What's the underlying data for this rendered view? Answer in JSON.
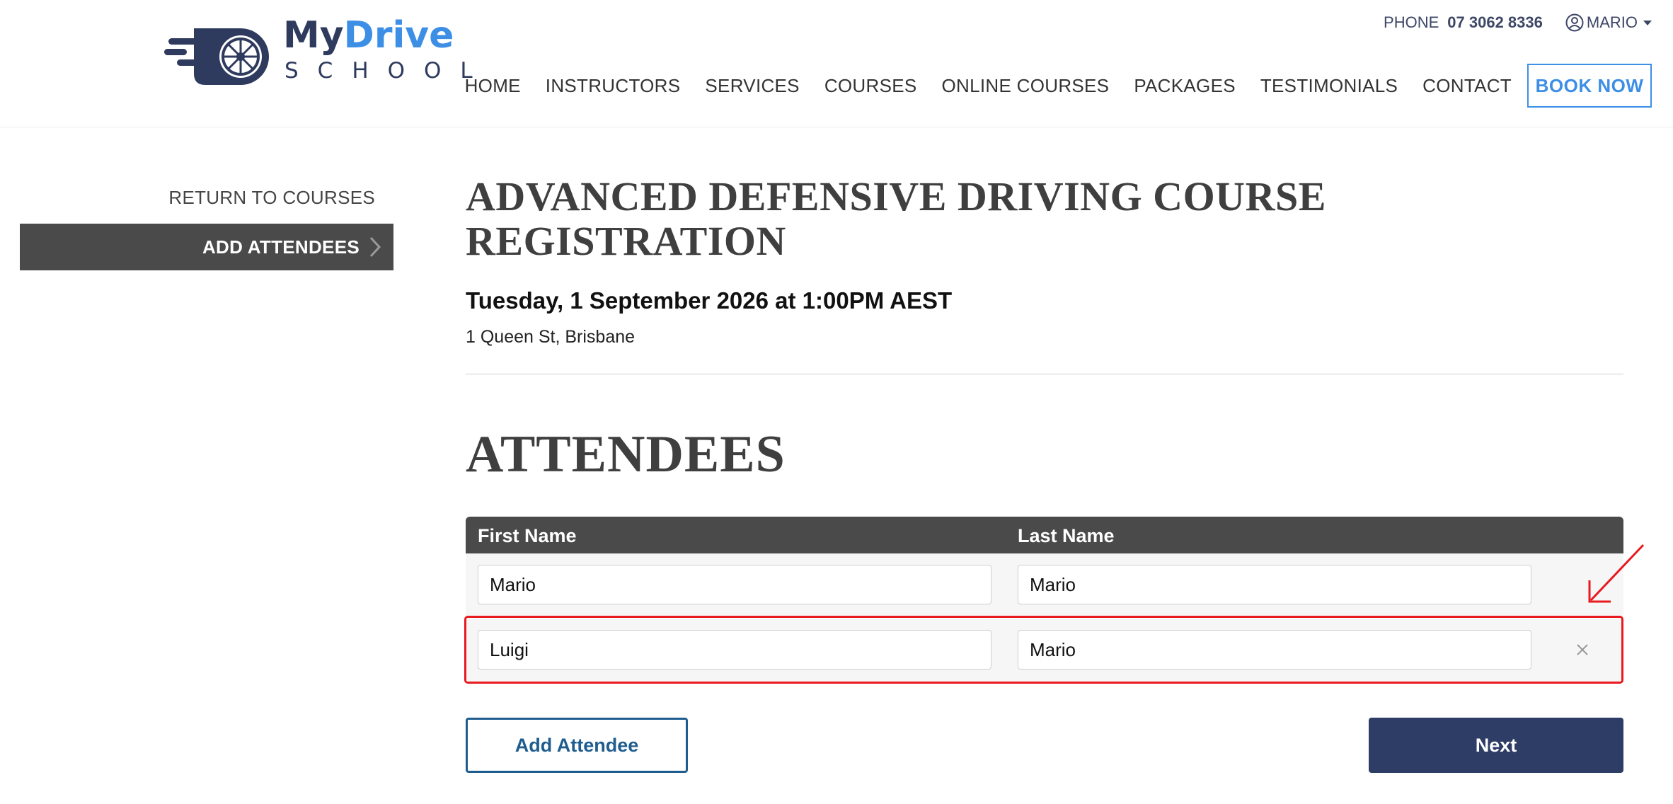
{
  "logo": {
    "brand_part1": "My",
    "brand_part2": "Drive",
    "tagline": "SCHOOL",
    "icon": "wheel-icon"
  },
  "topbar": {
    "phone_label": "PHONE",
    "phone_number": "07 3062 8336",
    "user_icon": "user-circle-icon",
    "user_name": "MARIO",
    "dropdown_icon": "caret-down-icon"
  },
  "nav": {
    "items": [
      "HOME",
      "INSTRUCTORS",
      "SERVICES",
      "COURSES",
      "ONLINE COURSES",
      "PACKAGES",
      "TESTIMONIALS",
      "CONTACT"
    ],
    "book_label": "BOOK NOW"
  },
  "sidebar": {
    "return_label": "RETURN TO COURSES",
    "active_label": "ADD ATTENDEES",
    "active_icon": "chevron-right-icon"
  },
  "course": {
    "title": "ADVANCED DEFENSIVE DRIVING COURSE REGISTRATION",
    "date": "Tuesday, 1 September 2026 at 1:00PM AEST",
    "location": "1 Queen St, Brisbane"
  },
  "attendees": {
    "heading": "ATTENDEES",
    "columns": [
      "First Name",
      "Last Name"
    ],
    "rows": [
      {
        "first": "Mario",
        "last": "Mario",
        "removable": false
      },
      {
        "first": "Luigi",
        "last": "Mario",
        "removable": true
      }
    ],
    "remove_icon": "close-icon"
  },
  "actions": {
    "add_label": "Add Attendee",
    "next_label": "Next"
  },
  "colors": {
    "brand_dark": "#2f3b5e",
    "brand_blue": "#3d8fe6",
    "header_bar": "#4a4a4a",
    "next_button": "#2e3d66",
    "add_button_border": "#1f5d8f",
    "annotation_red": "#e8191f"
  }
}
